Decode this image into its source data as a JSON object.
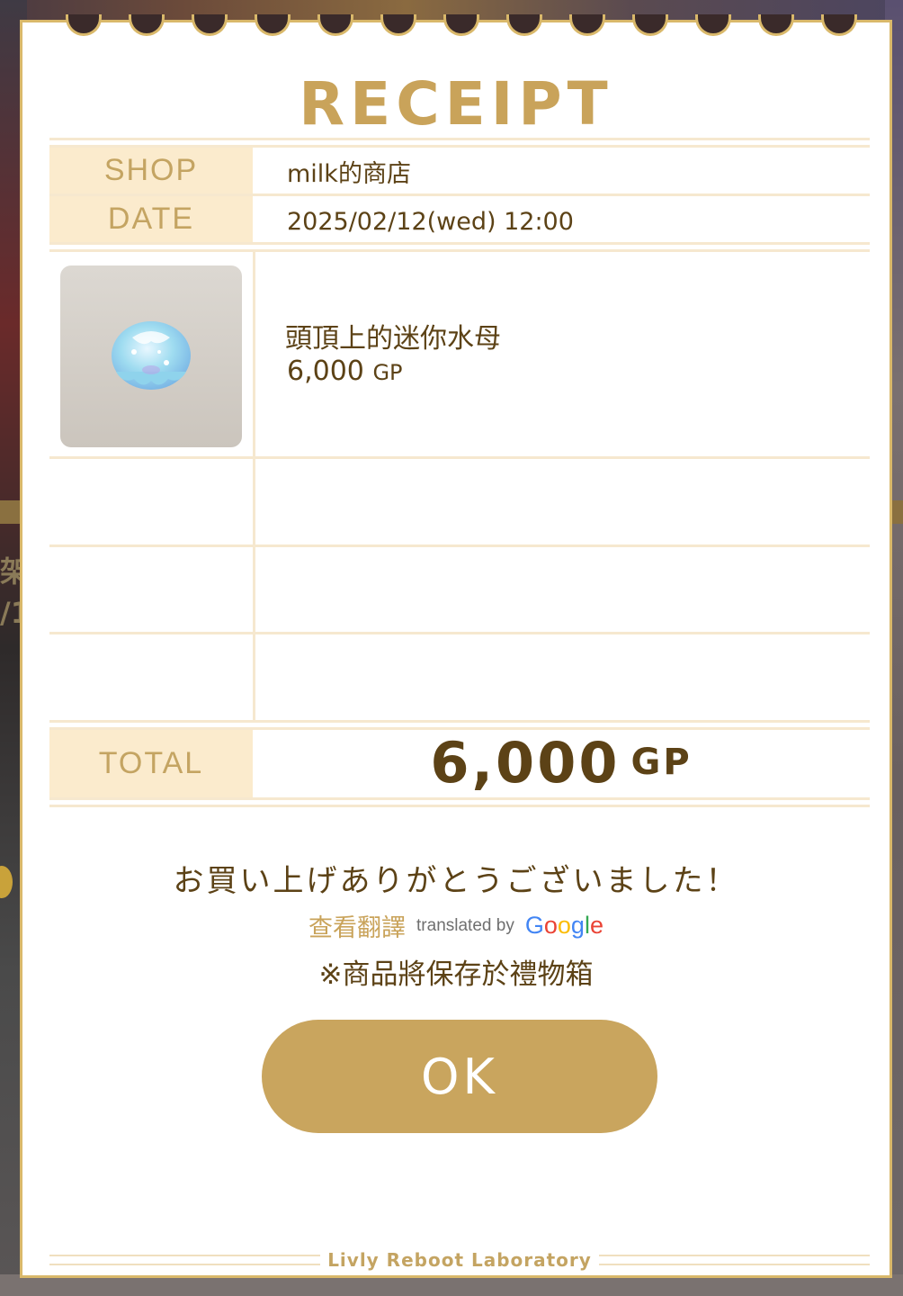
{
  "receipt": {
    "title": "RECEIPT",
    "shop_label": "SHOP",
    "shop_value": "milk的商店",
    "date_label": "DATE",
    "date_value": "2025/02/12(wed) 12:00",
    "item": {
      "name": "頭頂上的迷你水母",
      "price": "6,000",
      "unit": "GP",
      "icon": "jellyfish-icon"
    },
    "total_label": "TOTAL",
    "total_value": "6,000",
    "total_unit": "GP"
  },
  "message": {
    "thanks": "お買い上げありがとうございました！",
    "translate_link": "查看翻譯",
    "translated_by": "translated by",
    "google_letters": [
      "G",
      "o",
      "o",
      "g",
      "l",
      "e"
    ],
    "note": "※商品將保存於禮物箱"
  },
  "ok_button": "OK",
  "footer_brand": "Livly Reboot Laboratory",
  "colors": {
    "gold": "#c9a55e",
    "cream": "#fbebcd",
    "brown_text": "#5c4216",
    "google": [
      "#4285F4",
      "#EA4335",
      "#FBBC05",
      "#4285F4",
      "#34A853",
      "#EA4335"
    ]
  },
  "background": {
    "left_text_lines": [
      "架",
      "/1"
    ]
  }
}
